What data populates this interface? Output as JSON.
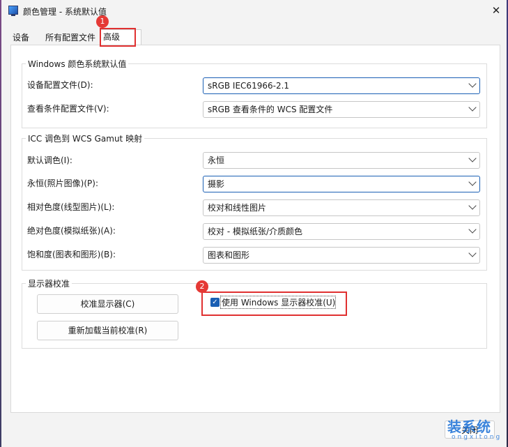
{
  "window": {
    "title": "颜色管理 - 系统默认值",
    "close_glyph": "✕"
  },
  "tabs": [
    {
      "label": "设备"
    },
    {
      "label": "所有配置文件"
    },
    {
      "label": "高级"
    }
  ],
  "windows_defaults": {
    "title": "Windows 颜色系统默认值",
    "rows": [
      {
        "label": "设备配置文件(D):",
        "value": "sRGB IEC61966-2.1"
      },
      {
        "label": "查看条件配置文件(V):",
        "value": "sRGB 查看条件的 WCS 配置文件"
      }
    ]
  },
  "icc": {
    "title": "ICC 调色到 WCS Gamut 映射",
    "rows": [
      {
        "label": "默认调色(I):",
        "value": "永恒"
      },
      {
        "label": "永恒(照片图像)(P):",
        "value": "摄影"
      },
      {
        "label": "相对色度(线型图片)(L):",
        "value": "校对和线性图片"
      },
      {
        "label": "绝对色度(模拟纸张)(A):",
        "value": "校对 - 模拟纸张/介质颜色"
      },
      {
        "label": "饱和度(图表和图形)(B):",
        "value": "图表和图形"
      }
    ]
  },
  "calibration": {
    "title": "显示器校准",
    "calibrate_button": "校准显示器(C)",
    "reload_button": "重新加载当前校准(R)",
    "checkbox_label": "使用 Windows 显示器校准(U)",
    "checkbox_checked": true
  },
  "footer": {
    "close_button": "关闭"
  },
  "annotations": {
    "badge1": "1",
    "badge2": "2",
    "color": "#e03030"
  },
  "watermark": {
    "main": "装系统",
    "sub": "ongxitong"
  }
}
